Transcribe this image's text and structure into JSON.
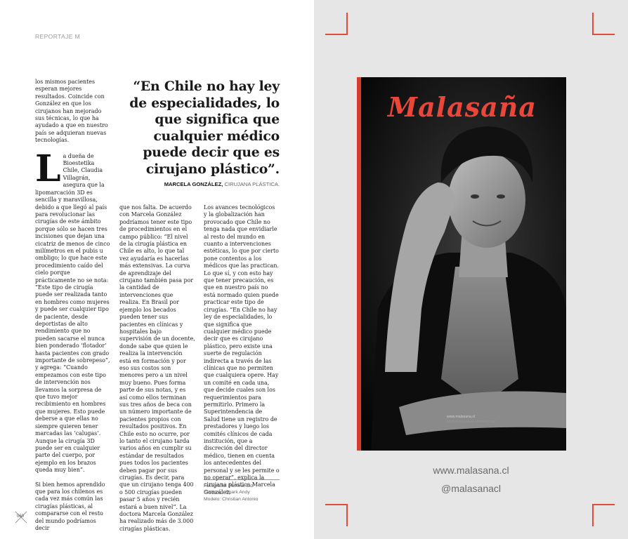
{
  "section_label": "REPORTAJE M",
  "quote": {
    "text": "“En Chile no hay ley de especialidades, lo que significa que cualquier médico puede decir que es cirujano plástico”.",
    "author": "MARCELA GONZÁLEZ,",
    "role": "CIRUJANA PLÁSTICA."
  },
  "column1": {
    "p1": "los mismos pacientes esperan mejores resultados. Coincide con González en que los cirujanos han mejorado sus técnicas, lo que ha ayudado a que en nuestro país se adquieran nuevas tecnologías.",
    "dropcap": "L",
    "p2": "a dueña de Bioestetika Chile, Claudia Villagrán, asegura que la lipomarcación 3D es sencilla y maravillosa, debido a que llegó al país para revolucionar las cirugías de este ámbito porque sólo se hacen tres incisiones que dejan una cicatriz de menos de cinco milímetros en el pubis u ombligo; lo que hace este procedimiento caído del cielo porque prácticamente no se nota: “Este tipo de cirugía puede ser realizada tanto en hombres como mujeres y puede ser cualquier tipo de paciente, desde deportistas de alto rendimiento que no pueden sacarse el nunca bien ponderado ‘flotador’ hasta pacientes con grado importante de sobrepeso”, y agrega: “Cuando empezamos con este tipo de intervención nos llevamos la sorpresa de que tuvo mejor recibimiento en hombres que mujeres. Esto puede deberse a que ellas no siempre quieren tener marcadas las ‘calugas’. Aunque la cirugía 3D puede ser en cualquier parte del cuerpo, por ejemplo en los brazos queda muy bien”.",
    "p3": "Si bien hemos aprendido que para los chilenos es cada vez más común las cirugías plásticas, al compararse con el resto del mundo podríamos decir"
  },
  "column2": {
    "p1": "que nos falta. De acuerdo con Marcela González podríamos tener este tipo de procedimientos en el campo público: “El nivel de la cirugía plástica en Chile es alto, lo que tal vez ayudaría es hacerlas más extensivas. La curva de aprendizaje del cirujano también pasa por la cantidad de intervenciones que realiza. En Brasil por ejemplo los becados pueden tener sus pacientes en clínicas y hospitales bajo supervisión de un docente, donde sabe que quien le realiza la intervención está en formación y por eso sus costos son menores pero a un nivel muy bueno. Pues forma parte de sus notas, y es así como ellos terminan sus tres años de beca con un número importante de pacientes propios con resultados positivos. En Chile esto no ocurre, por lo tanto el cirujano tarda varios años en cumplir su estándar de resultados pues todos los pacientes deben pagar por sus cirugías. Es decir, para que un cirujano tenga 400 o 500 cirugías pueden pasar 5 años y recién estará a buen nivel”. La doctora Marcela González ha realizado más de 3.000 cirugías plásticas."
  },
  "column3": {
    "p1": "Los avances tecnológicos y la globalización han provocado que Chile no tenga nada que envidiarle al resto del mundo en cuanto a intervenciones estéticas, lo que por cierto pone contentos a los médicos que las practican. Lo que sí, y con esto hay que tener precaución, es que en nuestro país no está normado quien puede practicar este tipo de cirugías. “En Chile no hay ley de especialidades, lo que significa que cualquier médico puede decir que es cirujano plástico, pero existe una suerte de regulación indirecta a través de las clínicas que no permiten que cualquiera opere. Hay un comité en cada una, que decide cuales son los requerimientos para permitirlo. Primero la Superintendencia de Salud tiene un registro de prestadores y luego los comités clínicos de cada institución, que a discreción del director médico, tienen en cuenta los antecedentes del personal y se les permite o no operar”, explica la cirujana plástica Marcela González."
  },
  "credits": {
    "photo": "Fotografía: Pamela Cid",
    "styling": "Estilismo: Spark Andy",
    "model": "Modelo: Christian Antonio"
  },
  "page_number": "060",
  "cover": {
    "logo": "Malasaña",
    "tag_url": "www.malasana.cl",
    "tag_issue": "EDICIÓN 51 | Enero - Febrero | 2017"
  },
  "website": "www.malasana.cl",
  "handle": "@malasanacl",
  "colors": {
    "accent": "#e14b3b",
    "right_page_bg": "#e6e6e6"
  }
}
